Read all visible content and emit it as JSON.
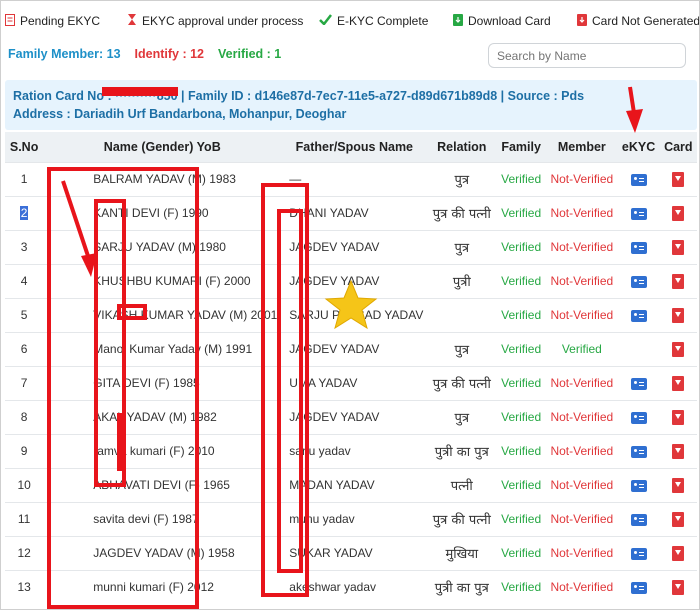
{
  "legend": {
    "pending": "Pending EKYC",
    "approval": "EKYC approval under process",
    "complete": "E-KYC Complete",
    "download": "Download Card",
    "not_generated": "Card Not Generated"
  },
  "summary": {
    "family": "Family Member: 13",
    "identify": "Identify : 12",
    "verified": "Verified : 1"
  },
  "search": {
    "placeholder": "Search by Name"
  },
  "info": {
    "line1": "Ration Card No : ··········850 | Family ID : d146e87d-7ec7-11e5-a727-d89d671b89d8 | Source : Pds",
    "line2": "Address : Dariadih Urf Bandarbona, Mohanpur, Deoghar"
  },
  "table": {
    "headers": [
      "S.No",
      "Name (Gender) YoB",
      "Father/Spous Name",
      "Relation",
      "Family",
      "Member",
      "eKYC",
      "Card"
    ],
    "rows": [
      {
        "sno": "1",
        "name": "BALRAM YADAV (M) 1983",
        "father": "—",
        "relation": "पुत्र",
        "family": "Verified",
        "member": "Not-Verified"
      },
      {
        "sno": "2",
        "name": "KANTI DEVI (F) 1990",
        "father": "DHANI YADAV",
        "relation": "पुत्र की पत्नी",
        "family": "Verified",
        "member": "Not-Verified"
      },
      {
        "sno": "3",
        "name": "SARJU YADAV (M) 1980",
        "father": "JAGDEV YADAV",
        "relation": "पुत्र",
        "family": "Verified",
        "member": "Not-Verified"
      },
      {
        "sno": "4",
        "name": "KHUSHBU KUMARI (F) 2000",
        "father": "JAGDEV YADAV",
        "relation": "पुत्री",
        "family": "Verified",
        "member": "Not-Verified"
      },
      {
        "sno": "5",
        "name": "VIKASH KUMAR YADAV (M) 2001",
        "father": "SARJU PRASAD YADAV",
        "relation": "",
        "family": "Verified",
        "member": "Not-Verified"
      },
      {
        "sno": "6",
        "name": "Manoj Kumar Yadav (M) 1991",
        "father": "JAGDEV YADAV",
        "relation": "पुत्र",
        "family": "Verified",
        "member": "Verified"
      },
      {
        "sno": "7",
        "name": "GITA DEVI (F) 1985",
        "father": "UMA YADAV",
        "relation": "पुत्र की पत्नी",
        "family": "Verified",
        "member": "Not-Verified"
      },
      {
        "sno": "8",
        "name": "AKAL YADAV (M) 1982",
        "father": "JAGDEV YADAV",
        "relation": "पुत्र",
        "family": "Verified",
        "member": "Not-Verified"
      },
      {
        "sno": "9",
        "name": "ramva kumari (F) 2010",
        "father": "sarju yadav",
        "relation": "पुत्री का पुत्र",
        "family": "Verified",
        "member": "Not-Verified"
      },
      {
        "sno": "10",
        "name": "ABHAVATI DEVI (F) 1965",
        "father": "MADAN YADAV",
        "relation": "पत्नी",
        "family": "Verified",
        "member": "Not-Verified"
      },
      {
        "sno": "11",
        "name": "savita devi (F) 1987",
        "father": "munu yadav",
        "relation": "पुत्र की पत्नी",
        "family": "Verified",
        "member": "Not-Verified"
      },
      {
        "sno": "12",
        "name": "JAGDEV YADAV (M) 1958",
        "father": "SUKAR YADAV",
        "relation": "मुखिया",
        "family": "Verified",
        "member": "Not-Verified"
      },
      {
        "sno": "13",
        "name": "munni kumari (F) 2012",
        "father": "akeshwar yadav",
        "relation": "पुत्री का पुत्र",
        "family": "Verified",
        "member": "Not-Verified"
      }
    ]
  },
  "icons": {
    "pending": "pending-ekyc-icon",
    "approval": "hourglass-icon",
    "complete": "checkmark-icon",
    "download": "download-file-icon",
    "not_generated": "card-not-generated-icon",
    "ekyc": "id-card-icon",
    "card": "pdf-download-icon",
    "annotation": "star-icon"
  },
  "colors": {
    "family_count": "#1e90c8",
    "identify": "#e0373a",
    "verified": "#27a844",
    "info_bg": "#e6f3fd",
    "info_text": "#1d6fa5",
    "annotation": "#e8141b",
    "star": "#f5c518"
  }
}
